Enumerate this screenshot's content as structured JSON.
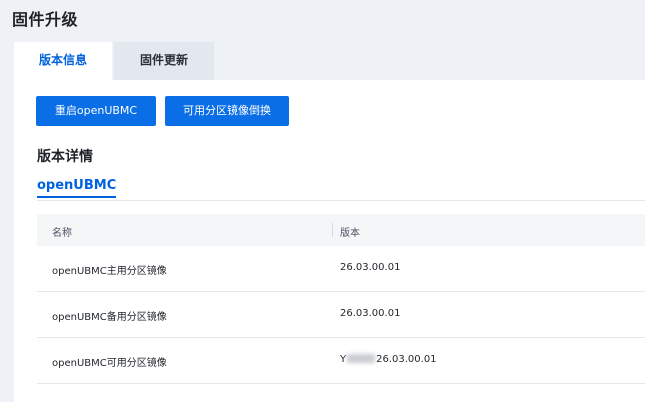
{
  "header": {
    "title": "固件升级"
  },
  "tabs": [
    {
      "label": "版本信息",
      "active": true
    },
    {
      "label": "固件更新",
      "active": false
    }
  ],
  "actions": {
    "reboot_label": "重启openUBMC",
    "switch_label": "可用分区镜像倒换"
  },
  "details": {
    "title": "版本详情",
    "subtab": "openUBMC"
  },
  "table": {
    "columns": [
      "名称",
      "版本"
    ],
    "rows": [
      {
        "name": "openUBMC主用分区镜像",
        "version": "26.03.00.01"
      },
      {
        "name": "openUBMC备用分区镜像",
        "version": "26.03.00.01"
      },
      {
        "name": "openUBMC可用分区镜像",
        "version_prefix": "Y",
        "version": "26.03.00.01"
      }
    ]
  },
  "colors": {
    "accent": "#0062dc",
    "button": "#0a6ee6",
    "page_bg": "#eef1f5"
  }
}
